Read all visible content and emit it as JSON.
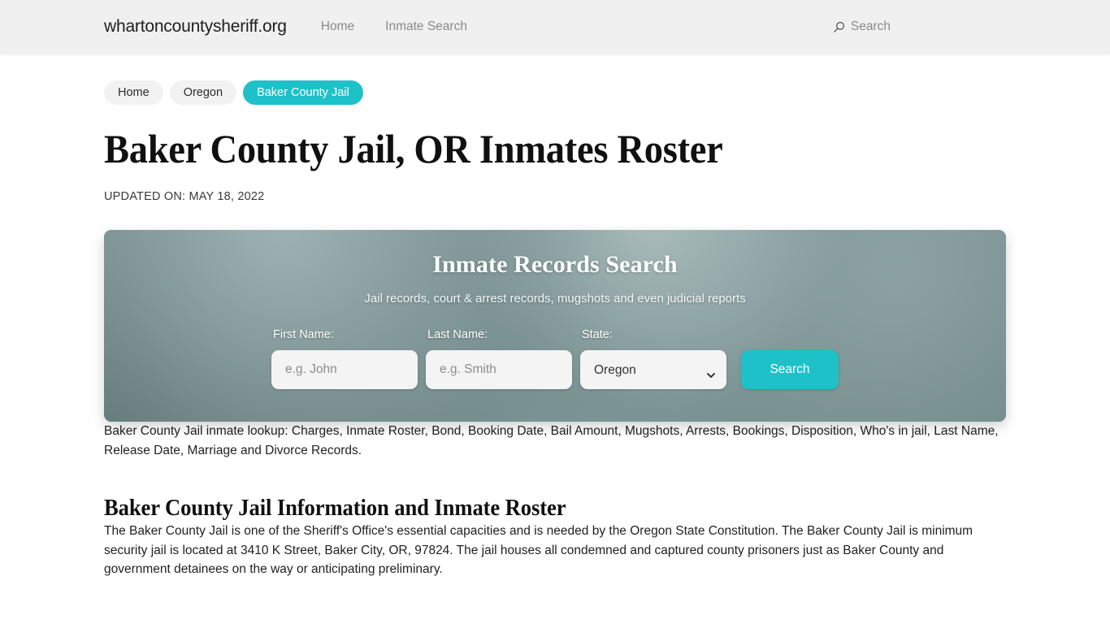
{
  "header": {
    "brand": "whartoncountysheriff.org",
    "nav": [
      {
        "label": "Home"
      },
      {
        "label": "Inmate Search"
      }
    ],
    "search_label": "Search",
    "search_icon": "search-icon"
  },
  "breadcrumb": [
    {
      "label": "Home",
      "active": false
    },
    {
      "label": "Oregon",
      "active": false
    },
    {
      "label": "Baker County Jail",
      "active": true
    }
  ],
  "page": {
    "title": "Baker County Jail, OR Inmates Roster",
    "updated": "UPDATED ON: MAY 18, 2022"
  },
  "search_panel": {
    "title": "Inmate Records Search",
    "subtitle": "Jail records, court & arrest records, mugshots and even judicial reports",
    "first_name": {
      "label": "First Name:",
      "placeholder": "e.g. John",
      "value": ""
    },
    "last_name": {
      "label": "Last Name:",
      "placeholder": "e.g. Smith",
      "value": ""
    },
    "state": {
      "label": "State:",
      "selected": "Oregon"
    },
    "submit_label": "Search",
    "accent_color": "#1fc1c9"
  },
  "content": {
    "intro": "Baker County Jail inmate lookup: Charges, Inmate Roster, Bond, Booking Date, Bail Amount, Mugshots, Arrests, Bookings, Disposition, Who's in jail, Last Name, Release Date, Marriage and Divorce Records.",
    "section_title": "Baker County Jail Information and Inmate Roster",
    "section_body": "The Baker County Jail is one of the Sheriff's Office's essential capacities and is needed by the Oregon State Constitution. The Baker County Jail is minimum security jail is located at 3410 K Street, Baker City, OR, 97824. The jail houses all condemned and captured county prisoners just as Baker County and government detainees on the way or anticipating preliminary."
  }
}
